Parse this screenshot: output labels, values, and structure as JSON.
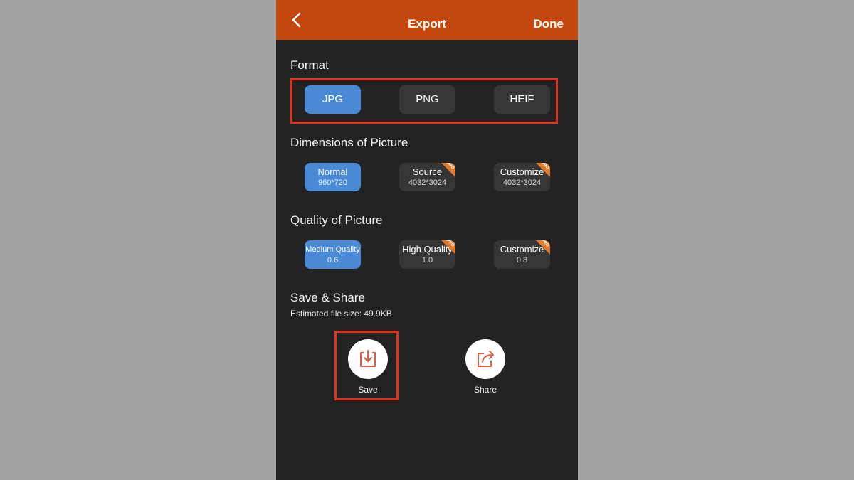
{
  "nav": {
    "title": "Export",
    "done_label": "Done",
    "back_icon": "chevron-left-icon"
  },
  "format": {
    "title": "Format",
    "options": [
      {
        "label": "JPG",
        "selected": true
      },
      {
        "label": "PNG",
        "selected": false
      },
      {
        "label": "HEIF",
        "selected": false
      }
    ]
  },
  "dimensions": {
    "title": "Dimensions of Picture",
    "options": [
      {
        "label": "Normal",
        "value": "960*720",
        "selected": true,
        "pro": false
      },
      {
        "label": "Source",
        "value": "4032*3024",
        "selected": false,
        "pro": true
      },
      {
        "label": "Customize",
        "value": "4032*3024",
        "selected": false,
        "pro": true
      }
    ]
  },
  "quality": {
    "title": "Quality of Picture",
    "options": [
      {
        "label": "Medium Quality",
        "value": "0.6",
        "selected": true,
        "pro": false
      },
      {
        "label": "High Quality",
        "value": "1.0",
        "selected": false,
        "pro": true
      },
      {
        "label": "Customize",
        "value": "0.8",
        "selected": false,
        "pro": true
      }
    ]
  },
  "save_share": {
    "title": "Save & Share",
    "estimated": "Estimated file size: 49.9KB",
    "save_label": "Save",
    "share_label": "Share"
  },
  "badge_text": "PRO",
  "colors": {
    "nav_bg": "#c2480f",
    "background": "#232323",
    "selected": "#4a8ad4",
    "unselected": "#363636",
    "highlight": "#e03322",
    "icon_accent": "#e05a47"
  }
}
